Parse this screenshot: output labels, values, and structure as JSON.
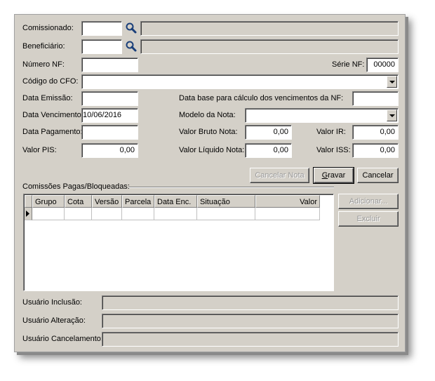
{
  "form": {
    "comissionado": {
      "label": "Comissionado:",
      "code": "",
      "name": ""
    },
    "beneficiario": {
      "label": "Beneficiário:",
      "code": "",
      "name": ""
    },
    "numero_nf": {
      "label": "Número NF:",
      "value": ""
    },
    "serie_nf": {
      "label": "Série NF:",
      "value": "00000"
    },
    "codigo_cfo": {
      "label": "Código do CFO:",
      "value": ""
    },
    "data_emissao": {
      "label": "Data Emissão:",
      "value": ""
    },
    "data_base": {
      "label": "Data base para cálculo dos vencimentos da NF:",
      "value": ""
    },
    "data_vencimento": {
      "label": "Data Vencimento:",
      "value": "10/06/2016"
    },
    "modelo_nota": {
      "label": "Modelo da Nota:",
      "value": ""
    },
    "data_pagamento": {
      "label": "Data Pagamento:",
      "value": ""
    },
    "valor_bruto": {
      "label": "Valor Bruto Nota:",
      "value": "0,00"
    },
    "valor_ir": {
      "label": "Valor IR:",
      "value": "0,00"
    },
    "valor_pis": {
      "label": "Valor PIS:",
      "value": "0,00"
    },
    "valor_liquido": {
      "label": "Valor Líquido Nota:",
      "value": "0,00"
    },
    "valor_iss": {
      "label": "Valor ISS:",
      "value": "0,00"
    }
  },
  "buttons": {
    "cancelar_nota": "Cancelar Nota",
    "gravar_underline": "G",
    "gravar_rest": "ravar",
    "cancelar": "Cancelar",
    "adicionar": "Adicionar...",
    "excluir": "Excluir"
  },
  "comissoes": {
    "group_label": "Comissões Pagas/Bloqueadas:",
    "columns": [
      "Grupo",
      "Cota",
      "Versão",
      "Parcela",
      "Data Enc.",
      "Situação",
      "Valor"
    ]
  },
  "audit": {
    "inclusao": {
      "label": "Usuário Inclusão:",
      "value": ""
    },
    "alteracao": {
      "label": "Usuário Alteração:",
      "value": ""
    },
    "cancelamento": {
      "label": "Usuário Cancelamento:",
      "value": ""
    }
  },
  "icons": {
    "search": "magnifier-icon",
    "dropdown": "chevron-down-icon",
    "row_indicator": "triangle-right-icon"
  }
}
